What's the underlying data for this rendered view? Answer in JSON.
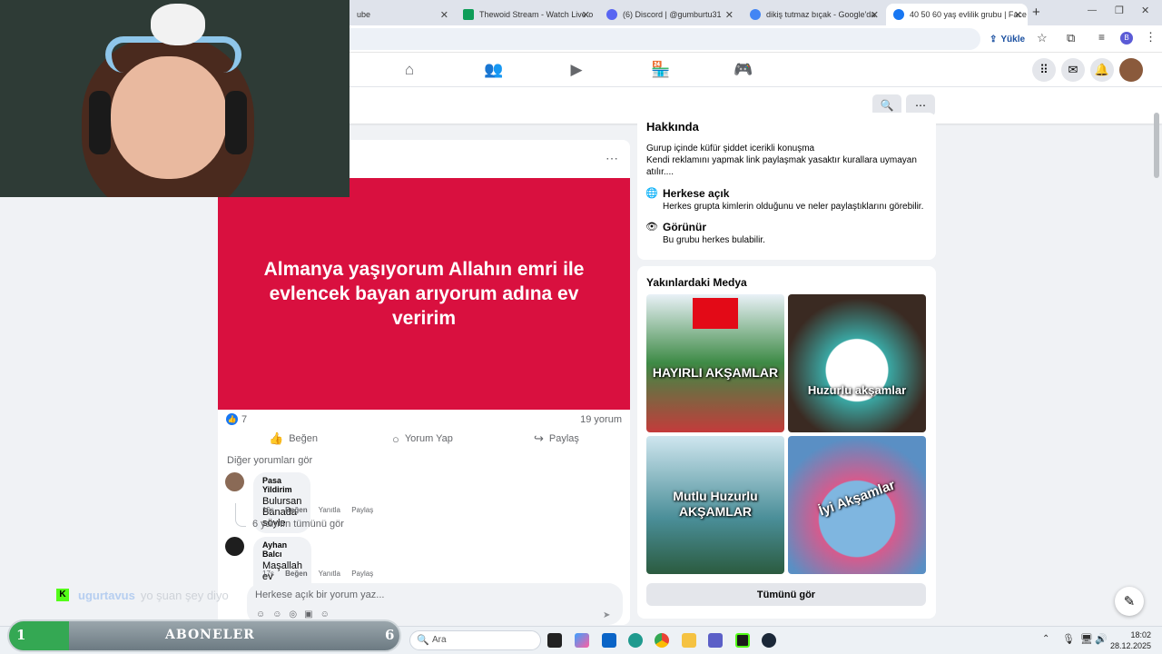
{
  "tabs": [
    {
      "title": "ube",
      "favicon_color": "#ff0000"
    },
    {
      "title": "Thewoid Stream - Watch Live o",
      "favicon_color": "#0e9d58"
    },
    {
      "title": "(6) Discord | @gumburtu31",
      "favicon_color": "#5865f2"
    },
    {
      "title": "dikiş tutmaz bıçak - Google'da",
      "favicon_color": "#4285f4"
    },
    {
      "title": "40 50 60 yaş evlilik grubu | Face",
      "favicon_color": "#1877f2"
    }
  ],
  "toolbar": {
    "upload_label": "Yükle",
    "profile_initial": "B"
  },
  "post": {
    "image_text": "Almanya yaşıyorum Allahın emri ile evlencek bayan arıyorum adına ev veririm",
    "image_color": "#d9103f",
    "reaction_count": "7",
    "comment_count": "19 yorum",
    "like_label": "Beğen",
    "comment_label": "Yorum Yap",
    "share_label": "Paylaş",
    "more_comments": "Diğer yorumları gör",
    "comments": [
      {
        "name": "Pasa Yildirim",
        "text": "Bulursan Banada söyle",
        "time": "19s",
        "like": "Beğen",
        "reply": "Yanıtla",
        "share": "Paylaş",
        "replies_link": "6 yanıtın tümünü gör"
      },
      {
        "name": "Ayhan Balcı",
        "text": "Maşallah ev bağışı yapılıyor",
        "time": "17s",
        "like": "Beğen",
        "reply": "Yanıtla",
        "share": "Paylaş"
      }
    ],
    "reply_placeholder": "Herkese açık bir yorum yaz..."
  },
  "about": {
    "title": "Hakkında",
    "description_line1": "Gurup içinde küfür şiddet icerikli konuşma",
    "description_line2": "Kendi reklamını yapmak link paylaşmak yasaktır kurallara uymayan atılır....",
    "public_title": "Herkese açık",
    "public_desc": "Herkes grupta kimlerin olduğunu ve neler paylaştıklarını görebilir.",
    "visible_title": "Görünür",
    "visible_desc": "Bu grubu herkes bulabilir."
  },
  "media": {
    "title": "Yakınlardaki Medya",
    "items": [
      {
        "caption": "HAYIRLI AKŞAMLAR",
        "color": "#2f7d3c"
      },
      {
        "caption": "Huzurlu akşamlar",
        "color": "#3a6e7a"
      },
      {
        "caption": "Mutlu Huzurlu AKŞAMLAR",
        "color": "#4a8e98"
      },
      {
        "caption": "İyi Akşamlar",
        "color": "#5a8fc4"
      }
    ],
    "see_all": "Tümünü gör"
  },
  "overlay": {
    "chat_user": "ugurtavus",
    "chat_text": "yo şuan şey diyo",
    "subs_count": "1",
    "subs_label": "ABONELER",
    "subs_right": "6"
  },
  "taskbar": {
    "search_placeholder": "Ara",
    "time": "18:02",
    "date": "28.12.2025"
  }
}
